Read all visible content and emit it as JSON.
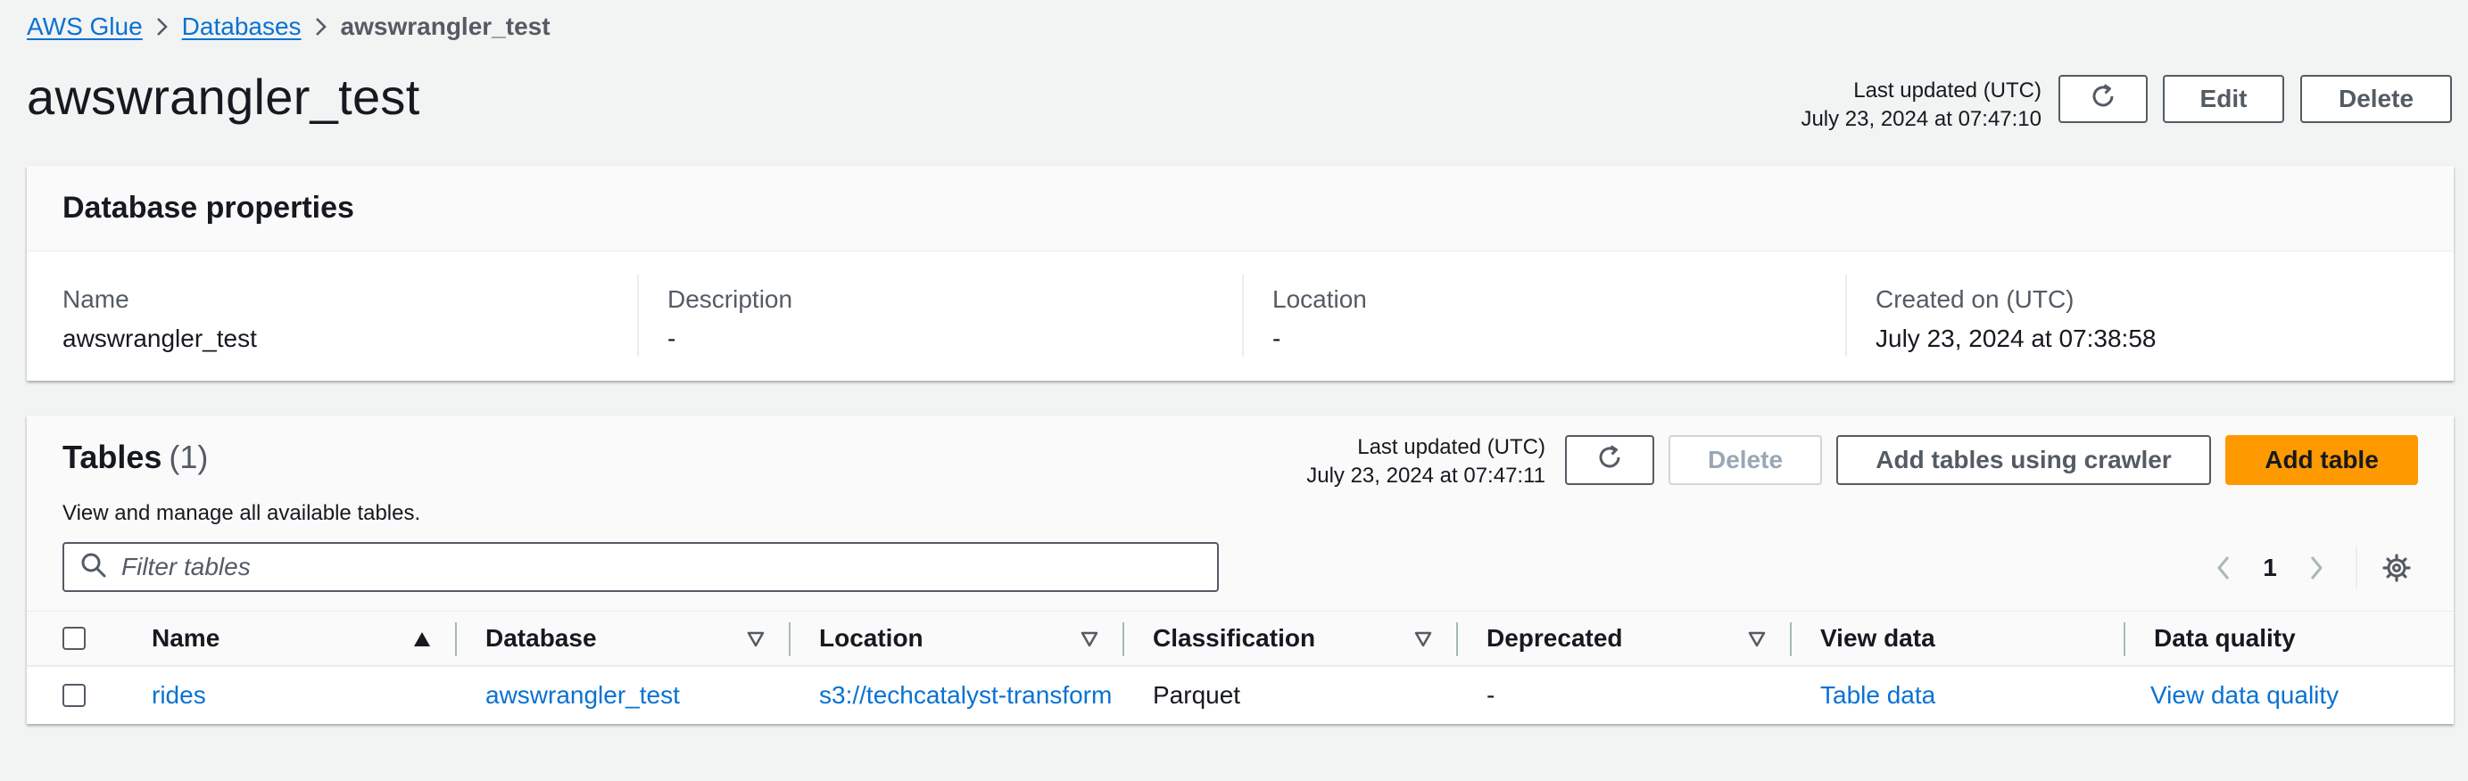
{
  "breadcrumb": {
    "items": [
      "AWS Glue",
      "Databases"
    ],
    "current": "awswrangler_test"
  },
  "header": {
    "title": "awswrangler_test",
    "last_updated_label": "Last updated (UTC)",
    "last_updated_value": "July 23, 2024 at 07:47:10",
    "edit_label": "Edit",
    "delete_label": "Delete"
  },
  "properties": {
    "title": "Database properties",
    "fields": [
      {
        "label": "Name",
        "value": "awswrangler_test"
      },
      {
        "label": "Description",
        "value": "-"
      },
      {
        "label": "Location",
        "value": "-"
      },
      {
        "label": "Created on (UTC)",
        "value": "July 23, 2024 at 07:38:58"
      }
    ]
  },
  "tables": {
    "title": "Tables",
    "count": "(1)",
    "description": "View and manage all available tables.",
    "last_updated_label": "Last updated (UTC)",
    "last_updated_value": "July 23, 2024 at 07:47:11",
    "delete_label": "Delete",
    "crawler_label": "Add tables using crawler",
    "add_label": "Add table",
    "filter_placeholder": "Filter tables",
    "page": "1",
    "columns": [
      "Name",
      "Database",
      "Location",
      "Classification",
      "Deprecated",
      "View data",
      "Data quality"
    ],
    "rows": [
      {
        "name": "rides",
        "database": "awswrangler_test",
        "location": "s3://techcatalyst-transform",
        "classification": "Parquet",
        "deprecated": "-",
        "view_data": "Table data",
        "data_quality": "View data quality"
      }
    ]
  },
  "colors": {
    "link": "#0972d3",
    "primary": "#ff9900",
    "background": "#f2f3f3"
  },
  "icons": [
    "chevron-right-icon",
    "refresh-icon",
    "search-icon",
    "chevron-left-icon",
    "gear-icon",
    "sort-ascending-icon",
    "sort-icon"
  ]
}
